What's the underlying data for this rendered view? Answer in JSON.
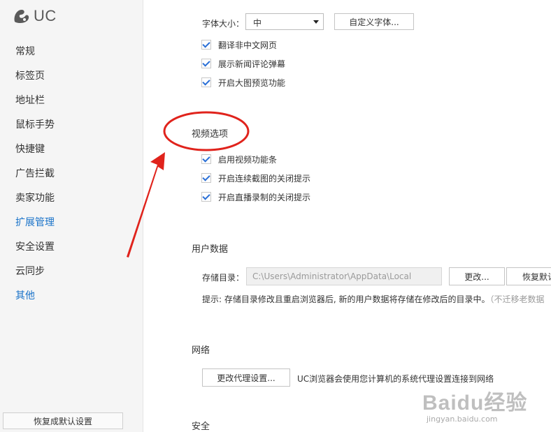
{
  "app": {
    "logo_text": "UC"
  },
  "sidebar": {
    "items": [
      {
        "label": "常规"
      },
      {
        "label": "标签页"
      },
      {
        "label": "地址栏"
      },
      {
        "label": "鼠标手势"
      },
      {
        "label": "快捷键"
      },
      {
        "label": "广告拦截"
      },
      {
        "label": "卖家功能"
      },
      {
        "label": "扩展管理"
      },
      {
        "label": "安全设置"
      },
      {
        "label": "云同步"
      },
      {
        "label": "其他"
      }
    ],
    "restore_default_label": "恢复成默认设置"
  },
  "font": {
    "size_label": "字体大小：",
    "size_value": "中",
    "custom_font_button": "自定义字体..."
  },
  "general_checkboxes": [
    {
      "label": "翻译非中文网页",
      "checked": true
    },
    {
      "label": "展示新闻评论弹幕",
      "checked": true
    },
    {
      "label": "开启大图预览功能",
      "checked": true
    }
  ],
  "video": {
    "title": "视频选项",
    "checkboxes": [
      {
        "label": "启用视频功能条",
        "checked": true
      },
      {
        "label": "开启连续截图的关闭提示",
        "checked": true
      },
      {
        "label": "开启直播录制的关闭提示",
        "checked": true
      }
    ]
  },
  "user_data": {
    "title": "用户数据",
    "dir_label": "存储目录：",
    "dir_value": "C:\\Users\\Administrator\\AppData\\Local",
    "change_button": "更改...",
    "restore_button": "恢复默认",
    "hint": "提示: 存储目录修改且重启浏览器后, 新的用户数据将存储在修改后的目录中。",
    "hint_extra": "（不迁移老数据"
  },
  "network": {
    "title": "网络",
    "proxy_button": "更改代理设置...",
    "description": "UC浏览器会使用您计算机的系统代理设置连接到网络"
  },
  "security": {
    "title": "安全"
  },
  "annotation": {
    "color": "#e0231c"
  },
  "watermark": {
    "main": "Baidu经验",
    "sub": "jingyan.baidu.com"
  },
  "colors": {
    "accent": "#1a73c9",
    "check": "#2a6fd6"
  }
}
